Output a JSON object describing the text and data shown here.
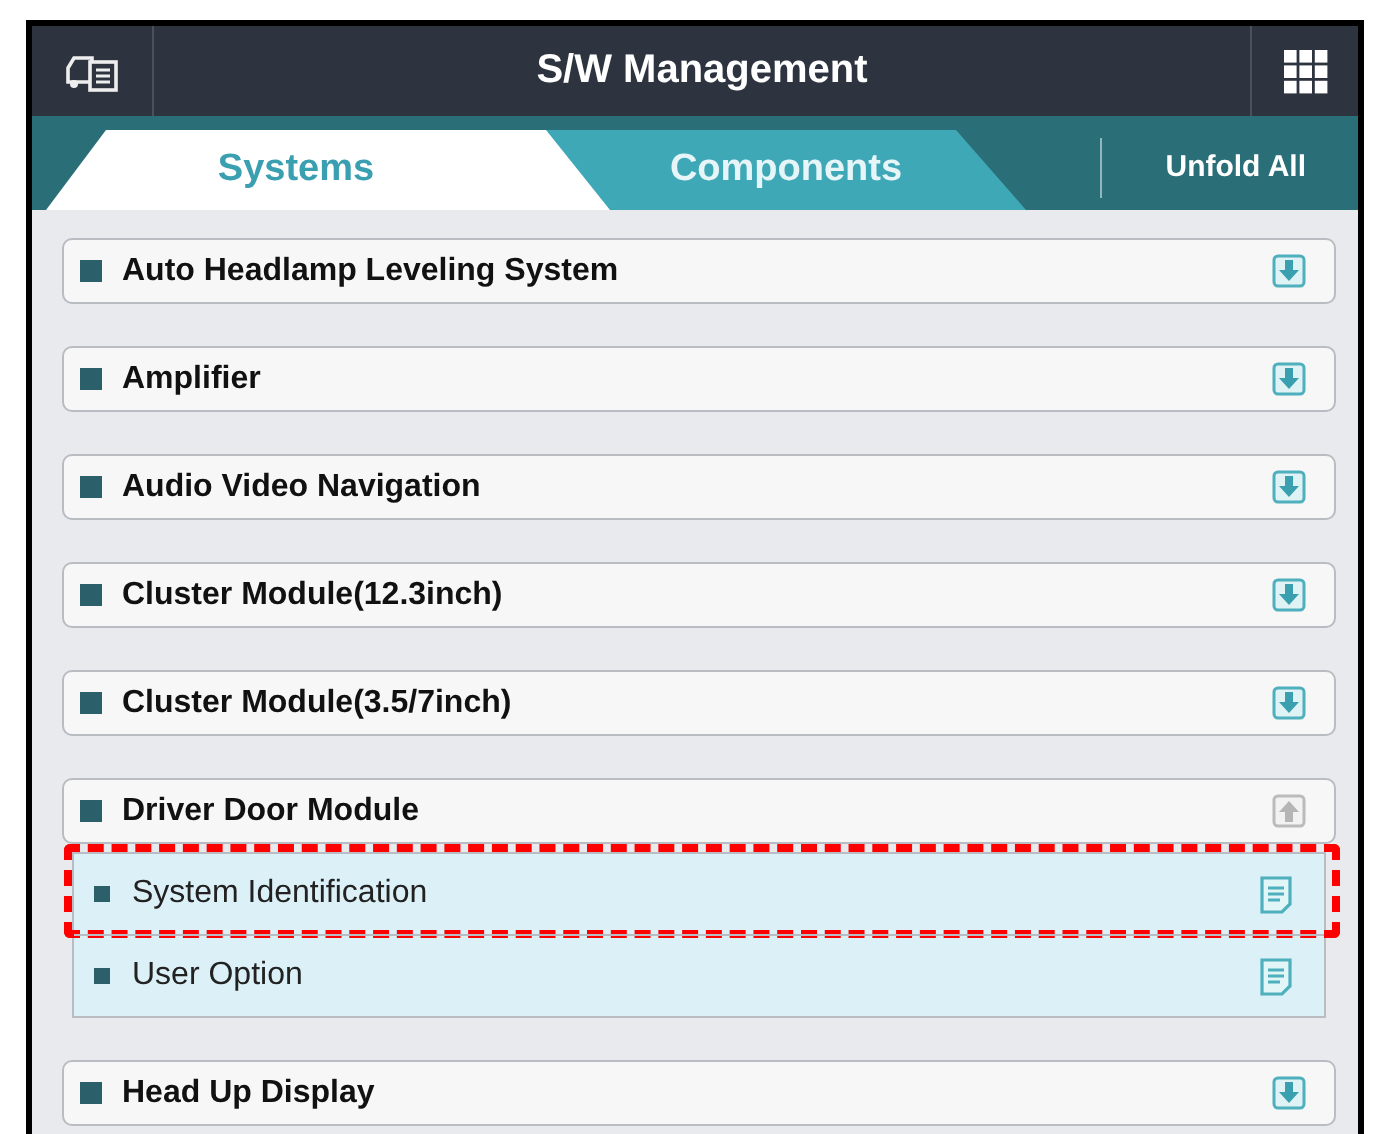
{
  "header": {
    "title": "S/W Management"
  },
  "tabs": [
    {
      "label": "Systems",
      "selected": true
    },
    {
      "label": "Components",
      "selected": false
    }
  ],
  "unfold_all": "Unfold All",
  "systems": [
    {
      "name": "Auto Headlamp Leveling System",
      "expanded": false
    },
    {
      "name": "Amplifier",
      "expanded": false
    },
    {
      "name": "Audio Video Navigation",
      "expanded": false
    },
    {
      "name": "Cluster Module(12.3inch)",
      "expanded": false
    },
    {
      "name": "Cluster Module(3.5/7inch)",
      "expanded": false
    },
    {
      "name": "Driver Door Module",
      "expanded": true,
      "children": [
        {
          "name": "System Identification",
          "highlighted": true
        },
        {
          "name": "User Option",
          "highlighted": false
        }
      ]
    },
    {
      "name": "Head Up Display",
      "expanded": false
    }
  ]
}
